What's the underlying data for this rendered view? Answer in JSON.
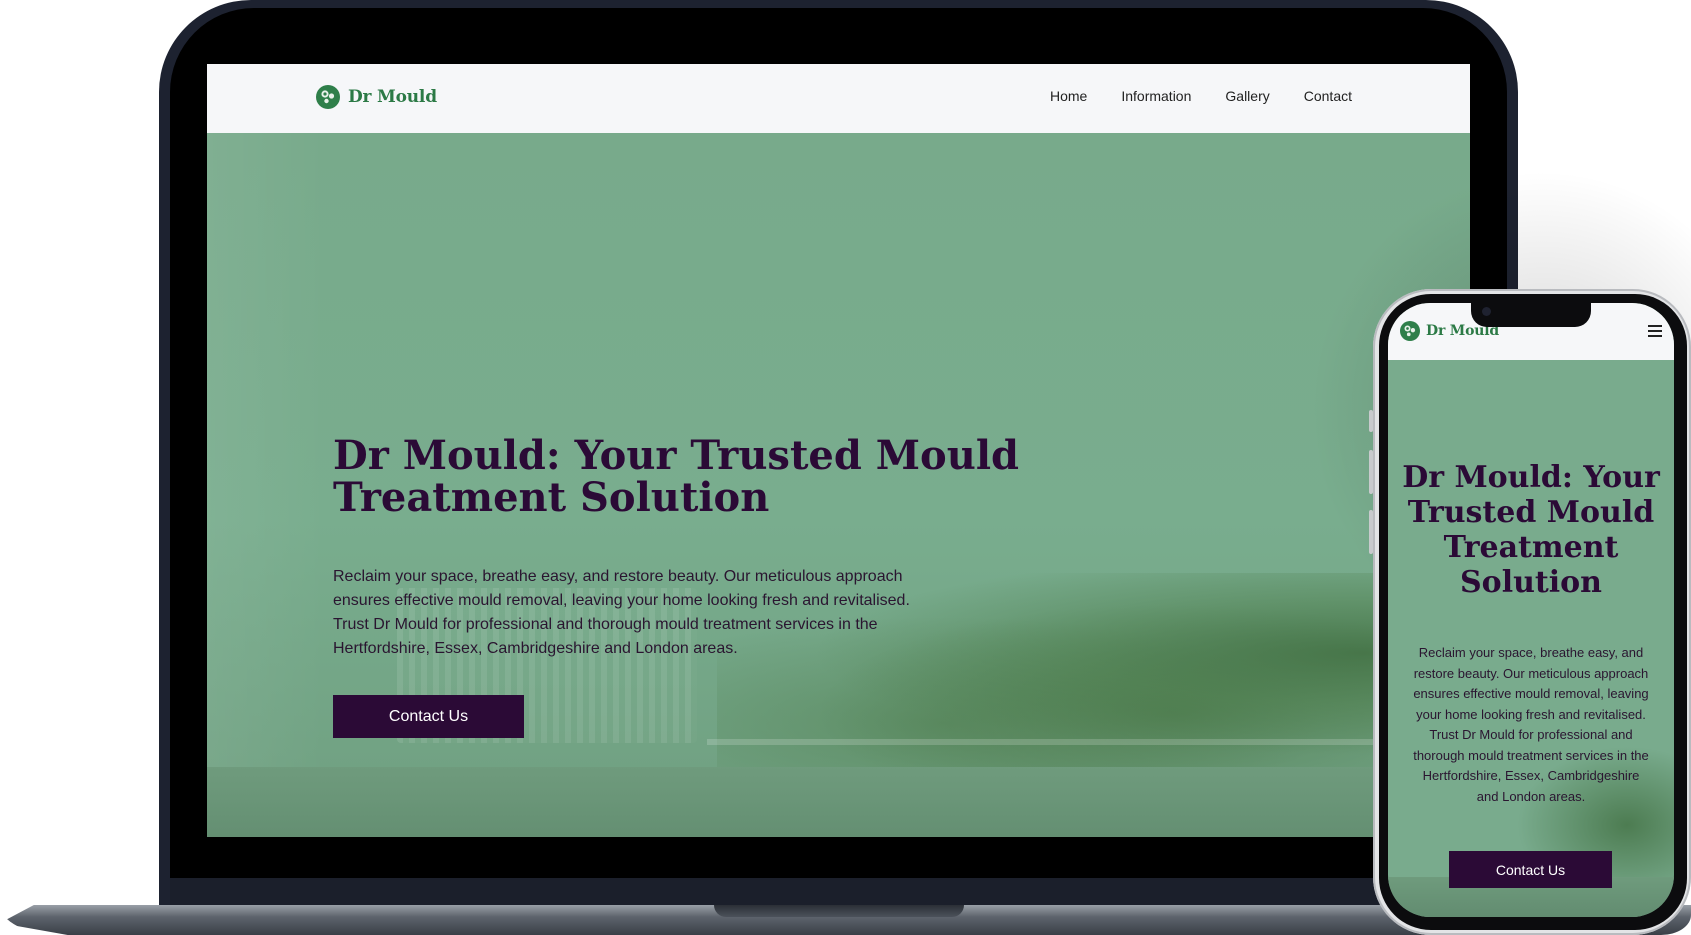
{
  "brand": {
    "name": "Dr Mould",
    "color": "#2c7a46"
  },
  "nav": {
    "links": [
      "Home",
      "Information",
      "Gallery",
      "Contact"
    ]
  },
  "hero": {
    "title": "Dr Mould: Your Trusted Mould Treatment Solution",
    "text": "Reclaim your space, breathe easy, and restore beauty. Our meticulous approach ensures effective mould removal, leaving your home looking fresh and revitalised. Trust Dr Mould for professional and thorough mould treatment services in the Hertfordshire, Essex, Cambridgeshire and London areas.",
    "cta_label": "Contact Us",
    "title_color": "#2b0a36",
    "overlay_color": "#78aa8b"
  },
  "mobile": {
    "menu_icon": "hamburger-menu-icon"
  }
}
